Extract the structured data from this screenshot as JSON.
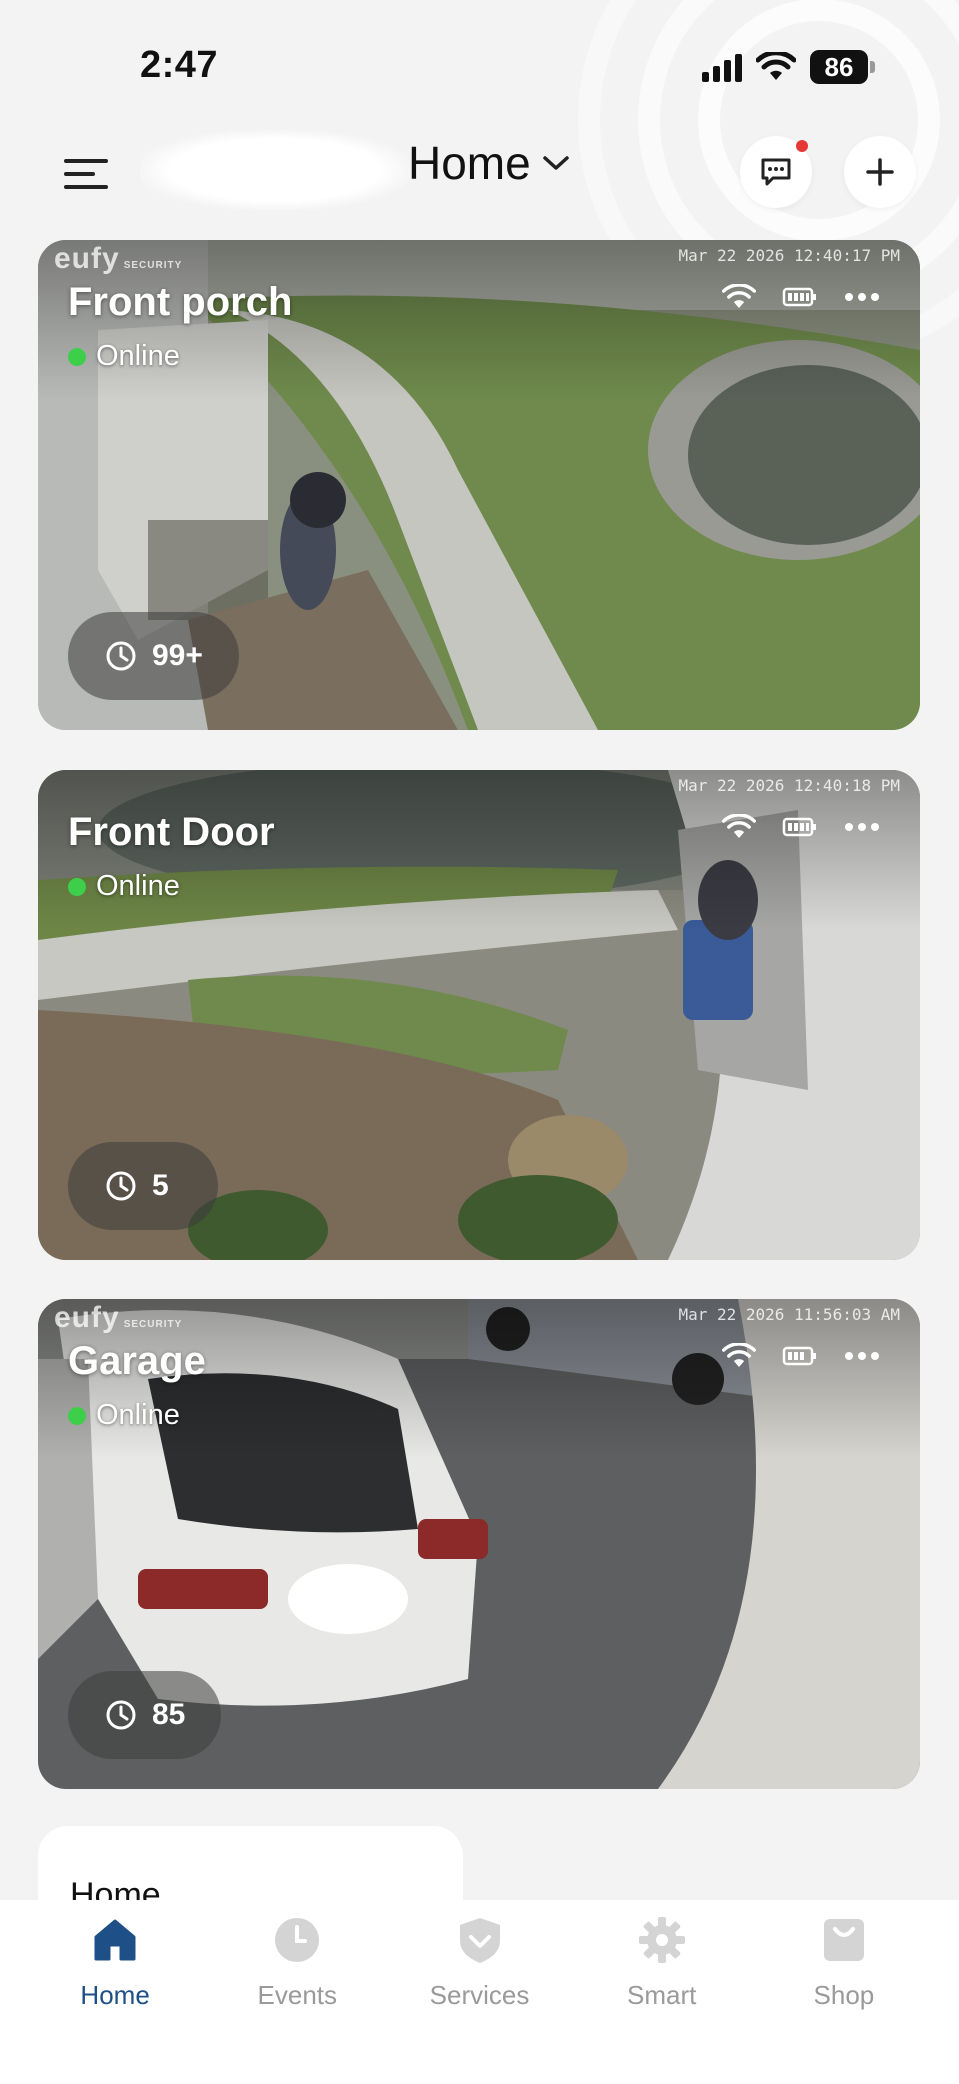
{
  "status_bar": {
    "time": "2:47",
    "battery": "86"
  },
  "header": {
    "title": "Home"
  },
  "cameras": [
    {
      "name": "Front porch",
      "status": "Online",
      "event_count": "99+",
      "timestamp": "Mar 22 2026  12:40:17 PM",
      "watermark": "eufy",
      "watermark_sub": "SECURITY"
    },
    {
      "name": "Front Door",
      "status": "Online",
      "event_count": "5",
      "timestamp": "Mar 22 2026  12:40:18 PM",
      "watermark": "",
      "watermark_sub": ""
    },
    {
      "name": "Garage",
      "status": "Online",
      "event_count": "85",
      "timestamp": "Mar 22 2026  11:56:03 AM",
      "watermark": "eufy",
      "watermark_sub": "SECURITY"
    }
  ],
  "home_section": {
    "title": "Home"
  },
  "nav": {
    "items": [
      {
        "label": "Home",
        "icon": "home-icon",
        "active": true
      },
      {
        "label": "Events",
        "icon": "clock-icon",
        "active": false
      },
      {
        "label": "Services",
        "icon": "shield-icon",
        "active": false
      },
      {
        "label": "Smart",
        "icon": "gear-icon",
        "active": false
      },
      {
        "label": "Shop",
        "icon": "bag-icon",
        "active": false
      }
    ]
  },
  "colors": {
    "accent": "#1e4f86",
    "online": "#3ecf4a",
    "badge": "#e53935"
  }
}
